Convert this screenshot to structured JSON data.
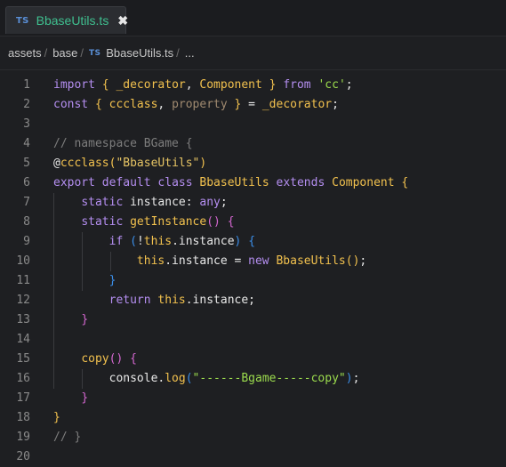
{
  "tab": {
    "badge": "TS",
    "label": "BbaseUtils.ts",
    "close": "✖"
  },
  "breadcrumb": [
    {
      "text": "assets"
    },
    {
      "text": "base"
    },
    {
      "text": "BbaseUtils.ts",
      "badge": "TS"
    },
    {
      "text": "..."
    }
  ],
  "breadcrumb_sep": "/",
  "lines": [
    {
      "n": "1",
      "segs": [
        [
          "kw",
          "import"
        ],
        [
          "pl",
          " "
        ],
        [
          "br1",
          "{"
        ],
        [
          "pl",
          " "
        ],
        [
          "fn",
          "_decorator"
        ],
        [
          "pl",
          ", "
        ],
        [
          "fn",
          "Component"
        ],
        [
          "pl",
          " "
        ],
        [
          "br1",
          "}"
        ],
        [
          "pl",
          " "
        ],
        [
          "kw",
          "from"
        ],
        [
          "pl",
          " "
        ],
        [
          "str",
          "'cc'"
        ],
        [
          "pl",
          ";"
        ]
      ]
    },
    {
      "n": "2",
      "segs": [
        [
          "kw",
          "const"
        ],
        [
          "pl",
          " "
        ],
        [
          "br1",
          "{"
        ],
        [
          "pl",
          " "
        ],
        [
          "fn",
          "ccclass"
        ],
        [
          "pl",
          ", "
        ],
        [
          "dim",
          "property"
        ],
        [
          "pl",
          " "
        ],
        [
          "br1",
          "}"
        ],
        [
          "pl",
          " = "
        ],
        [
          "fn",
          "_decorator"
        ],
        [
          "pl",
          ";"
        ]
      ]
    },
    {
      "n": "3",
      "segs": []
    },
    {
      "n": "4",
      "segs": [
        [
          "cm",
          "// namespace BGame {"
        ]
      ]
    },
    {
      "n": "5",
      "segs": [
        [
          "pl",
          "@"
        ],
        [
          "fn",
          "ccclass"
        ],
        [
          "br1",
          "("
        ],
        [
          "str2",
          "\"BbaseUtils\""
        ],
        [
          "br1",
          ")"
        ]
      ]
    },
    {
      "n": "6",
      "segs": [
        [
          "kw",
          "export"
        ],
        [
          "pl",
          " "
        ],
        [
          "kw",
          "default"
        ],
        [
          "pl",
          " "
        ],
        [
          "kw",
          "class"
        ],
        [
          "pl",
          " "
        ],
        [
          "fn",
          "BbaseUtils"
        ],
        [
          "pl",
          " "
        ],
        [
          "kw",
          "extends"
        ],
        [
          "pl",
          " "
        ],
        [
          "fn",
          "Component"
        ],
        [
          "pl",
          " "
        ],
        [
          "br1",
          "{"
        ]
      ]
    },
    {
      "n": "7",
      "segs": [
        [
          "pl",
          "    "
        ],
        [
          "kw",
          "static"
        ],
        [
          "pl",
          " instance: "
        ],
        [
          "ty",
          "any"
        ],
        [
          "pl",
          ";"
        ]
      ]
    },
    {
      "n": "8",
      "segs": [
        [
          "pl",
          "    "
        ],
        [
          "kw",
          "static"
        ],
        [
          "pl",
          " "
        ],
        [
          "fn",
          "getInstance"
        ],
        [
          "br2",
          "()"
        ],
        [
          "pl",
          " "
        ],
        [
          "br2",
          "{"
        ]
      ]
    },
    {
      "n": "9",
      "segs": [
        [
          "pl",
          "        "
        ],
        [
          "kw",
          "if"
        ],
        [
          "pl",
          " "
        ],
        [
          "br3",
          "("
        ],
        [
          "pl",
          "!"
        ],
        [
          "fn",
          "this"
        ],
        [
          "pl",
          ".instance"
        ],
        [
          "br3",
          ")"
        ],
        [
          "pl",
          " "
        ],
        [
          "br3",
          "{"
        ]
      ]
    },
    {
      "n": "10",
      "segs": [
        [
          "pl",
          "            "
        ],
        [
          "fn",
          "this"
        ],
        [
          "pl",
          ".instance = "
        ],
        [
          "kw",
          "new"
        ],
        [
          "pl",
          " "
        ],
        [
          "fn",
          "BbaseUtils"
        ],
        [
          "br1",
          "()"
        ],
        [
          "pl",
          ";"
        ]
      ]
    },
    {
      "n": "11",
      "segs": [
        [
          "pl",
          "        "
        ],
        [
          "br3",
          "}"
        ]
      ]
    },
    {
      "n": "12",
      "segs": [
        [
          "pl",
          "        "
        ],
        [
          "kw",
          "return"
        ],
        [
          "pl",
          " "
        ],
        [
          "fn",
          "this"
        ],
        [
          "pl",
          ".instance;"
        ]
      ]
    },
    {
      "n": "13",
      "segs": [
        [
          "pl",
          "    "
        ],
        [
          "br2",
          "}"
        ]
      ]
    },
    {
      "n": "14",
      "segs": []
    },
    {
      "n": "15",
      "segs": [
        [
          "pl",
          "    "
        ],
        [
          "fn",
          "copy"
        ],
        [
          "br2",
          "()"
        ],
        [
          "pl",
          " "
        ],
        [
          "br2",
          "{"
        ]
      ]
    },
    {
      "n": "16",
      "segs": [
        [
          "pl",
          "        console."
        ],
        [
          "fn",
          "log"
        ],
        [
          "br3",
          "("
        ],
        [
          "str",
          "\"------Bgame-----copy\""
        ],
        [
          "br3",
          ")"
        ],
        [
          "pl",
          ";"
        ]
      ]
    },
    {
      "n": "17",
      "segs": [
        [
          "pl",
          "    "
        ],
        [
          "br2",
          "}"
        ]
      ]
    },
    {
      "n": "18",
      "segs": [
        [
          "br1",
          "}"
        ]
      ]
    },
    {
      "n": "19",
      "segs": [
        [
          "cm",
          "// }"
        ]
      ]
    },
    {
      "n": "20",
      "segs": []
    }
  ]
}
